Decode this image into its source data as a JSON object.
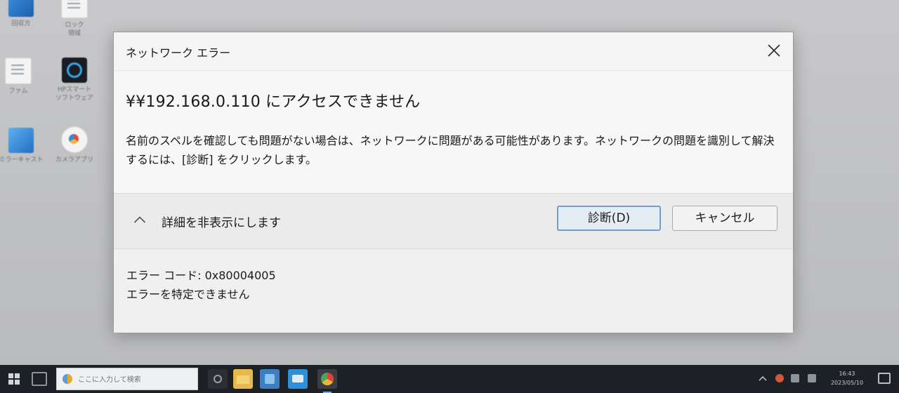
{
  "desktop": {
    "icons": [
      {
        "label": "回収方",
        "icon": "blue-app-icon"
      },
      {
        "label": "ロック\n領域",
        "icon": "document-icon"
      },
      {
        "label": "ファム",
        "icon": "document-icon"
      },
      {
        "label": "HPスマート\nソフトウェア",
        "icon": "hp-icon"
      },
      {
        "label": "ミラーキャスト",
        "icon": "windows-app-icon"
      },
      {
        "label": "カメラアプリ",
        "icon": "app-icon"
      }
    ]
  },
  "dialog": {
    "title": "ネットワーク エラー",
    "heading": "¥¥192.168.0.110 にアクセスできません",
    "message": "名前のスペルを確認しても問題がない場合は、ネットワークに問題がある可能性があります。ネットワークの問題を識別して解決するには、[診断] をクリックします。",
    "details_toggle_label": "詳細を非表示にします",
    "buttons": {
      "diagnose": "診断(D)",
      "cancel": "キャンセル"
    },
    "details": {
      "error_code": "エラー コード: 0x80004005",
      "error_description": "エラーを特定できません"
    },
    "icons": {
      "close": "close-icon",
      "toggle": "chevron-up-icon"
    }
  },
  "taskbar": {
    "search_placeholder": "ここに入力して検索",
    "clock_time": "16:43",
    "clock_date": "2023/05/10"
  },
  "colors": {
    "primary_button_border": "#6f9fcf",
    "taskbar": "#1d2024",
    "desktop": "#c4c5c7"
  }
}
